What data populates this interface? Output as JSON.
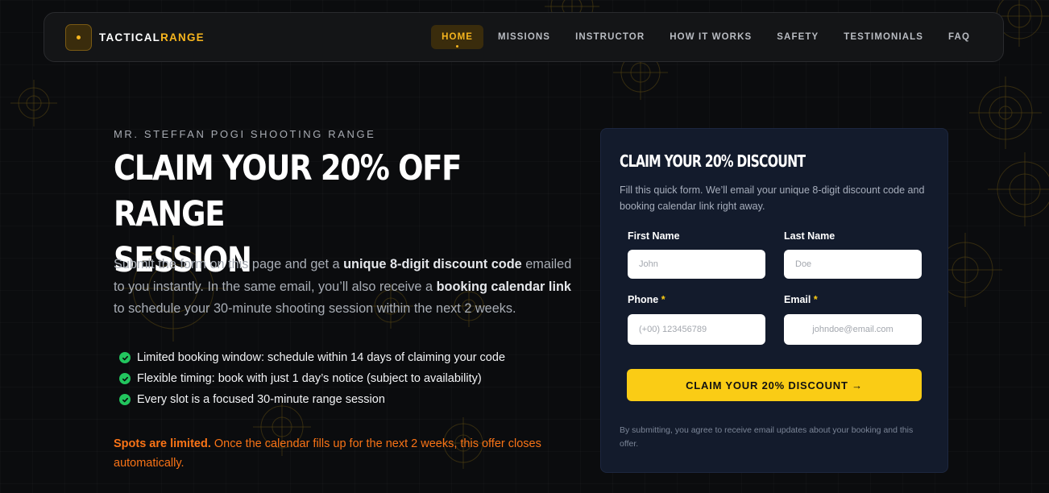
{
  "brand": {
    "name_main": "TACTICAL",
    "name_accent": "RANGE"
  },
  "nav": {
    "items": [
      {
        "label": "HOME",
        "active": true
      },
      {
        "label": "MISSIONS"
      },
      {
        "label": "INSTRUCTOR"
      },
      {
        "label": "HOW IT WORKS"
      },
      {
        "label": "SAFETY"
      },
      {
        "label": "TESTIMONIALS"
      },
      {
        "label": "FAQ"
      }
    ]
  },
  "hero": {
    "eyebrow": "MR. STEFFAN POGI SHOOTING RANGE",
    "headline_line1": "CLAIM YOUR 20% OFF RANGE",
    "headline_line2": "SESSION",
    "intro": {
      "p1": "Submit the form on this page and get a ",
      "b1": "unique 8-digit discount code",
      "p2": " emailed to you instantly. In the same email, you’ll also receive a ",
      "b2": "booking calendar link",
      "p3": " to schedule your 30-minute shooting session within the next 2 weeks."
    },
    "benefits": [
      "Limited booking window: schedule within 14 days of claiming your code",
      "Flexible timing: book with just 1 day’s notice (subject to availability)",
      "Every slot is a focused 30-minute range session"
    ],
    "limited_strong": "Spots are limited.",
    "limited_rest": " Once the calendar fills up for the next 2 weeks, this offer closes automatically."
  },
  "form": {
    "title": "CLAIM YOUR 20% DISCOUNT",
    "description": "Fill this quick form. We’ll email your unique 8-digit discount code and booking calendar link right away.",
    "first_name": {
      "label": "First Name",
      "placeholder": "John",
      "value": ""
    },
    "last_name": {
      "label": "Last Name",
      "placeholder": "Doe",
      "value": ""
    },
    "phone": {
      "label": "Phone",
      "required_mark": "*",
      "placeholder": "(+00) 123456789",
      "value": ""
    },
    "email": {
      "label": "Email",
      "required_mark": "*",
      "placeholder": "johndoe@email.com",
      "value": ""
    },
    "submit_label": "CLAIM YOUR 20% DISCOUNT →",
    "consent": "By submitting, you agree to receive email updates about your booking and this offer."
  },
  "colors": {
    "background": "#0b0c0e",
    "accent": "#f6b51e",
    "button": "#facc15",
    "card": "#131b2c",
    "check": "#22c55e",
    "warning": "#f97316"
  },
  "icons": [
    "logo-dot-icon",
    "check-circle-icon",
    "crosshair-target-icon"
  ]
}
